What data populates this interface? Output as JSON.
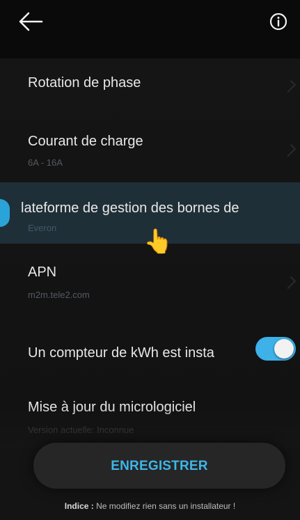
{
  "header": {
    "back_icon": "arrow-left-icon",
    "info_icon": "info-circle-icon"
  },
  "items": [
    {
      "title": "Rotation de phase",
      "subtitle": ""
    },
    {
      "title": "Courant de charge",
      "subtitle": "6A - 16A"
    },
    {
      "title": "lateforme de gestion des bornes de",
      "subtitle": "Everon"
    },
    {
      "title": "APN",
      "subtitle": "m2m.tele2.com"
    },
    {
      "title": "Un compteur de kWh est insta",
      "subtitle": "",
      "toggle_on": true
    },
    {
      "title": "Mise à jour du micrologiciel",
      "subtitle": "Version actuelle: Inconnue"
    }
  ],
  "save_button": {
    "label": "ENREGISTRER"
  },
  "hint": {
    "prefix": "Indice :",
    "text": " Ne modifiez rien sans un installateur !"
  },
  "colors": {
    "accent": "#3db7ea",
    "background": "#141414",
    "highlight_row": "#1f2f38"
  },
  "pointer_icon": "hand-pointer-icon"
}
